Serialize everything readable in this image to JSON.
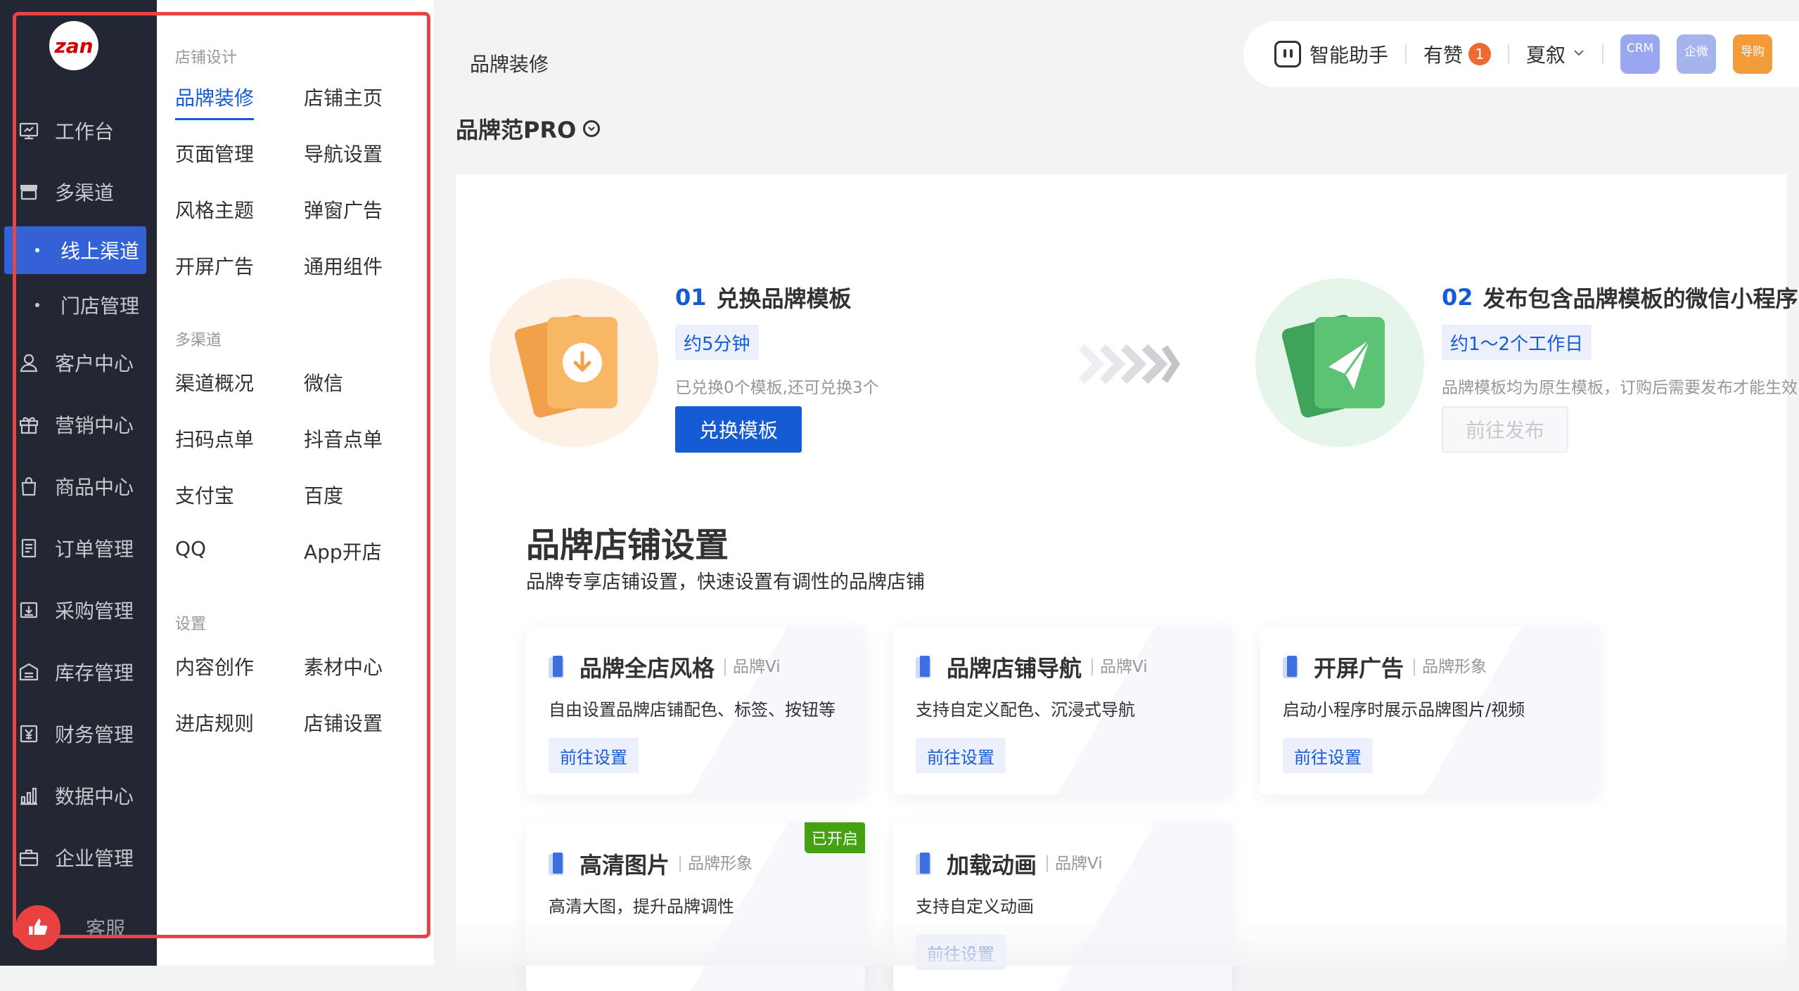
{
  "sidebar": {
    "logo_text": "zan",
    "items": [
      {
        "label": "工作台",
        "icon": "workbench-icon"
      },
      {
        "label": "多渠道",
        "icon": "store-icon"
      },
      {
        "label": "客户中心",
        "icon": "user-icon"
      },
      {
        "label": "营销中心",
        "icon": "gift-icon"
      },
      {
        "label": "商品中心",
        "icon": "bag-icon"
      },
      {
        "label": "订单管理",
        "icon": "order-icon"
      },
      {
        "label": "采购管理",
        "icon": "purchase-icon"
      },
      {
        "label": "库存管理",
        "icon": "warehouse-icon"
      },
      {
        "label": "财务管理",
        "icon": "finance-icon"
      },
      {
        "label": "数据中心",
        "icon": "chart-icon"
      },
      {
        "label": "企业管理",
        "icon": "briefcase-icon"
      }
    ],
    "sub_items": [
      {
        "label": "线上渠道",
        "active": true
      },
      {
        "label": "门店管理",
        "active": false
      }
    ],
    "service_label": "客服"
  },
  "submenu": {
    "groups": [
      {
        "title": "店铺设计",
        "links": [
          "品牌装修",
          "店铺主页",
          "页面管理",
          "导航设置",
          "风格主题",
          "弹窗广告",
          "开屏广告",
          "通用组件"
        ]
      },
      {
        "title": "多渠道",
        "links": [
          "渠道概况",
          "微信",
          "扫码点单",
          "抖音点单",
          "支付宝",
          "百度",
          "QQ",
          "App开店"
        ]
      },
      {
        "title": "设置",
        "links": [
          "内容创作",
          "素材中心",
          "进店规则",
          "店铺设置"
        ]
      }
    ],
    "active_link": "品牌装修"
  },
  "header": {
    "breadcrumb": "品牌装修",
    "assistant_label": "智能助手",
    "likes_label": "有赞",
    "likes_badge": "1",
    "user_name": "夏叙",
    "apps": [
      {
        "label": "CRM",
        "color": "#9aa7f0"
      },
      {
        "label": "企微",
        "color": "#a6b4ee"
      },
      {
        "label": "导购",
        "color": "#f29b3a"
      }
    ]
  },
  "brand": {
    "name": "品牌范PRO"
  },
  "steps": [
    {
      "num": "01",
      "title": "兑换品牌模板",
      "tag": "约5分钟",
      "desc": "已兑换0个模板,还可兑换3个",
      "button": "兑换模板"
    },
    {
      "num": "02",
      "title": "发布包含品牌模板的微信小程序",
      "tag": "约1～2个工作日",
      "desc": "品牌模板均为原生模板，订购后需要发布才能生效",
      "button": "前往发布"
    }
  ],
  "section": {
    "title": "品牌店铺设置",
    "subtitle": "品牌专享店铺设置，快速设置有调性的品牌店铺"
  },
  "cards": [
    {
      "title": "品牌全店风格",
      "category": "品牌Vi",
      "desc": "自由设置品牌店铺配色、标签、按钮等",
      "button": "前往设置",
      "flag": ""
    },
    {
      "title": "品牌店铺导航",
      "category": "品牌Vi",
      "desc": "支持自定义配色、沉浸式导航",
      "button": "前往设置",
      "flag": ""
    },
    {
      "title": "开屏广告",
      "category": "品牌形象",
      "desc": "启动小程序时展示品牌图片/视频",
      "button": "前往设置",
      "flag": ""
    },
    {
      "title": "高清图片",
      "category": "品牌形象",
      "desc": "高清大图，提升品牌调性",
      "button": "",
      "flag": "已开启"
    },
    {
      "title": "加载动画",
      "category": "品牌Vi",
      "desc": "支持自定义动画",
      "button": "前往设置",
      "flag": ""
    }
  ],
  "colors": {
    "primary": "#155bd4",
    "sidebar_bg": "#232734",
    "highlight": "#e54545"
  }
}
